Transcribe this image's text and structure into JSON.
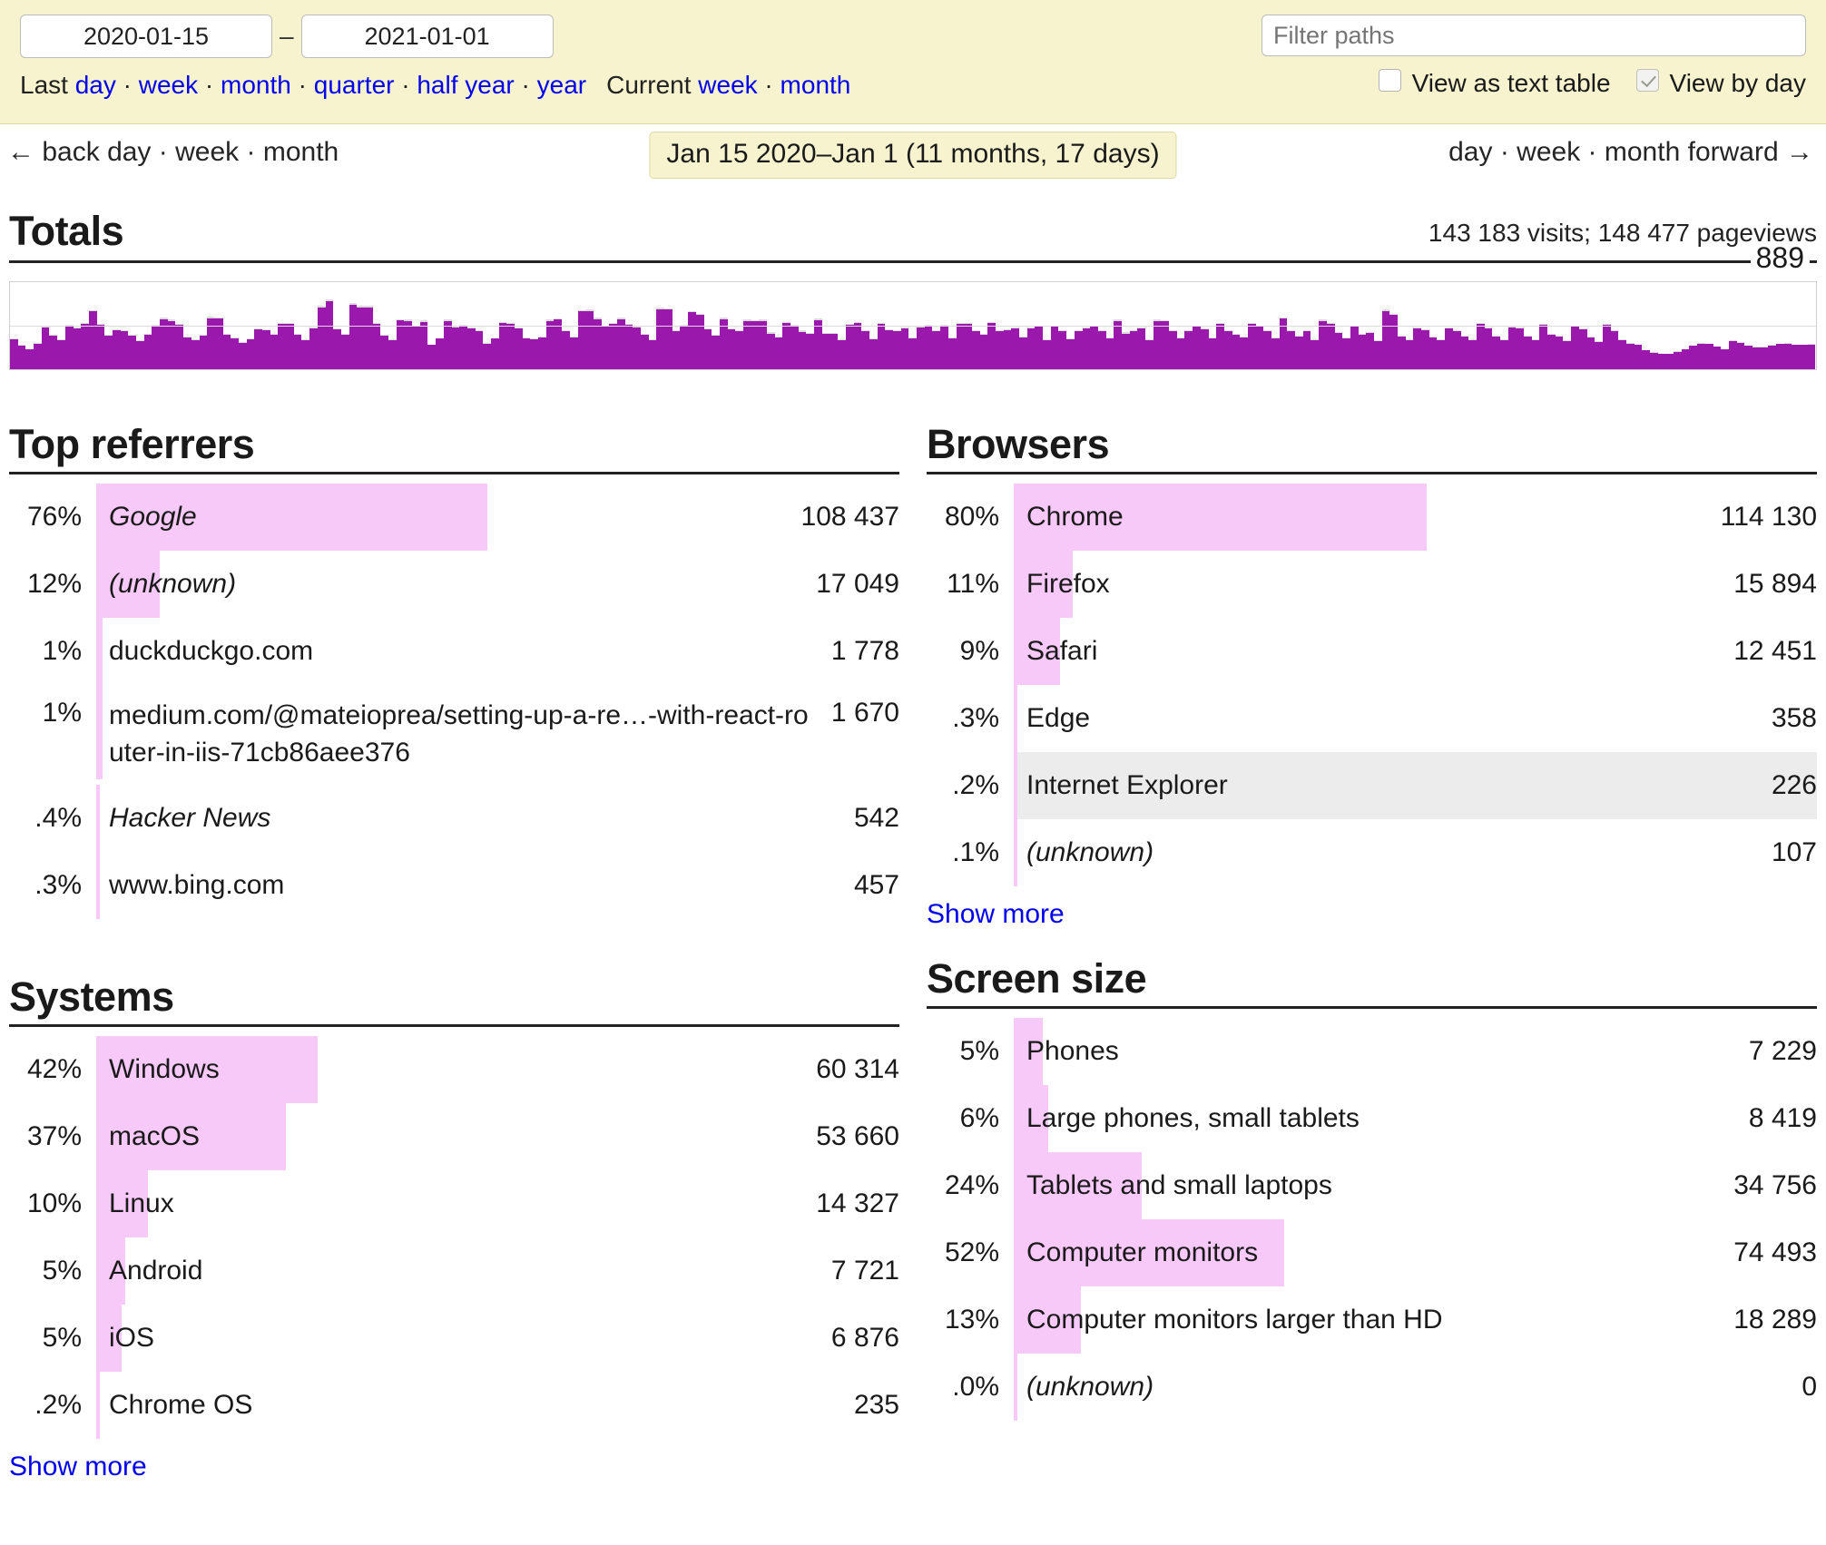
{
  "filter_bar": {
    "date_start": "2020-01-15",
    "date_end": "2021-01-01",
    "dash": "–",
    "last_label": "Last",
    "last_links": [
      "day",
      "week",
      "month",
      "quarter",
      "half year",
      "year"
    ],
    "current_label": "Current",
    "current_links": [
      "week",
      "month"
    ],
    "filter_placeholder": "Filter paths",
    "filter_value": "",
    "checkbox_text_table": "View as text table",
    "checkbox_text_table_checked": false,
    "checkbox_by_day": "View by day",
    "checkbox_by_day_checked": true
  },
  "nav": {
    "back_arrow": "←",
    "back_label": "back",
    "back_links": [
      "day",
      "week",
      "month"
    ],
    "range_badge": "Jan 15 2020–Jan 1 (11 months, 17 days)",
    "forward_links": [
      "day",
      "week",
      "month"
    ],
    "forward_label": "forward",
    "forward_arrow": "→"
  },
  "totals": {
    "title": "Totals",
    "summary": "143 183 visits; 148 477 pageviews",
    "chart_max_label": "889"
  },
  "colors": {
    "visits_bar": "#9a18ab",
    "pageviews_bar": "#dcdcdc",
    "stat_bar": "#f7c9f9",
    "hover_row": "#ececec",
    "link": "#0000ee",
    "header_bg": "#f7f3cf"
  },
  "chart_data": {
    "type": "bar",
    "title": "Totals",
    "xlabel": "",
    "ylabel": "visits",
    "ylim": [
      0,
      889
    ],
    "grid": true,
    "legend": [],
    "annotations": [
      "889"
    ],
    "series": [
      {
        "name": "pageviews",
        "values": [
          310,
          248,
          205,
          268,
          430,
          352,
          300,
          452,
          420,
          470,
          600,
          460,
          352,
          400,
          392,
          352,
          296,
          356,
          452,
          520,
          500,
          462,
          330,
          300,
          352,
          528,
          524,
          360,
          324,
          272,
          312,
          416,
          400,
          360,
          468,
          470,
          354,
          300,
          420,
          640,
          708,
          416,
          360,
          672,
          640,
          640,
          470,
          352,
          306,
          508,
          500,
          440,
          492,
          250,
          316,
          500,
          434,
          450,
          420,
          392,
          268,
          316,
          478,
          470,
          420,
          320,
          312,
          330,
          500,
          512,
          392,
          330,
          600,
          604,
          520,
          440,
          470,
          520,
          460,
          430,
          360,
          300,
          624,
          618,
          392,
          452,
          590,
          560,
          410,
          352,
          520,
          416,
          392,
          500,
          494,
          500,
          372,
          330,
          480,
          450,
          390,
          368,
          510,
          364,
          364,
          300,
          460,
          476,
          392,
          310,
          470,
          404,
          392,
          420,
          324,
          430,
          452,
          392,
          452,
          324,
          470,
          470,
          392,
          356,
          480,
          392,
          404,
          420,
          326,
          420,
          440,
          300,
          440,
          392,
          310,
          392,
          420,
          440,
          392,
          324,
          500,
          372,
          392,
          420,
          300,
          500,
          494,
          392,
          324,
          392,
          440,
          410,
          324,
          470,
          392,
          356,
          330,
          470,
          440,
          392,
          324,
          524,
          392,
          340,
          392,
          300,
          500,
          470,
          378,
          324,
          440,
          356,
          378,
          290,
          604,
          560,
          340,
          304,
          420,
          400,
          330,
          300,
          420,
          392,
          340,
          300,
          470,
          420,
          340,
          300,
          436,
          420,
          340,
          300,
          458,
          360,
          338,
          290,
          440,
          410,
          330,
          280,
          460,
          392,
          300,
          266,
          252,
          196,
          170,
          158,
          160,
          180,
          206,
          240,
          262,
          260,
          232,
          206,
          290,
          276,
          240,
          228,
          226,
          246,
          260,
          262,
          252,
          250,
          256
        ]
      },
      {
        "name": "visits",
        "values": [
          300,
          240,
          198,
          260,
          418,
          340,
          292,
          440,
          410,
          458,
          584,
          448,
          342,
          390,
          382,
          342,
          288,
          346,
          440,
          506,
          488,
          450,
          322,
          292,
          342,
          514,
          510,
          350,
          316,
          264,
          304,
          404,
          390,
          350,
          456,
          458,
          344,
          292,
          410,
          624,
          690,
          404,
          350,
          654,
          624,
          624,
          458,
          342,
          298,
          494,
          488,
          428,
          480,
          244,
          308,
          488,
          422,
          438,
          410,
          382,
          260,
          308,
          466,
          458,
          410,
          312,
          304,
          322,
          488,
          500,
          382,
          322,
          584,
          588,
          506,
          428,
          458,
          506,
          448,
          418,
          350,
          292,
          608,
          602,
          382,
          440,
          574,
          546,
          400,
          342,
          506,
          404,
          382,
          488,
          482,
          488,
          362,
          322,
          468,
          438,
          380,
          358,
          496,
          354,
          354,
          292,
          448,
          464,
          382,
          302,
          458,
          394,
          382,
          410,
          316,
          418,
          440,
          382,
          440,
          316,
          458,
          458,
          382,
          346,
          468,
          382,
          394,
          410,
          318,
          410,
          428,
          292,
          428,
          382,
          302,
          382,
          410,
          428,
          382,
          316,
          488,
          362,
          382,
          410,
          292,
          488,
          482,
          382,
          316,
          382,
          428,
          400,
          316,
          458,
          382,
          346,
          322,
          458,
          428,
          382,
          316,
          510,
          382,
          332,
          382,
          292,
          488,
          458,
          368,
          316,
          428,
          346,
          368,
          282,
          588,
          546,
          332,
          296,
          410,
          390,
          322,
          292,
          410,
          382,
          332,
          292,
          458,
          410,
          332,
          292,
          424,
          410,
          332,
          292,
          446,
          350,
          330,
          282,
          428,
          400,
          322,
          272,
          448,
          382,
          292,
          258,
          244,
          190,
          164,
          152,
          154,
          174,
          200,
          234,
          256,
          254,
          226,
          200,
          282,
          268,
          234,
          222,
          220,
          240,
          254,
          256,
          246,
          244,
          250
        ]
      }
    ]
  },
  "panels": {
    "top_referrers": {
      "title": "Top referrers",
      "rows": [
        {
          "pct": "76%",
          "name": "Google",
          "count": "108 437",
          "bar": 57.0,
          "italic": true,
          "hovered": false,
          "wrap": false
        },
        {
          "pct": "12%",
          "name": "(unknown)",
          "count": "17 049",
          "bar": 9.0,
          "italic": true,
          "hovered": false,
          "wrap": false
        },
        {
          "pct": "1%",
          "name": "duckduckgo.com",
          "count": "1 778",
          "bar": 0.9,
          "italic": false,
          "hovered": false,
          "wrap": false
        },
        {
          "pct": "1%",
          "name": "medium.com/@mateioprea/setting-up-a-re…-with-react-router-in-iis-71cb86aee376",
          "count": "1 670",
          "bar": 0.9,
          "italic": false,
          "hovered": false,
          "wrap": true
        },
        {
          "pct": ".4%",
          "name": "Hacker News",
          "count": "542",
          "bar": 0.5,
          "italic": true,
          "hovered": false,
          "wrap": false
        },
        {
          "pct": ".3%",
          "name": "www.bing.com",
          "count": "457",
          "bar": 0.4,
          "italic": false,
          "hovered": false,
          "wrap": false
        }
      ],
      "show_more": null
    },
    "browsers": {
      "title": "Browsers",
      "rows": [
        {
          "pct": "80%",
          "name": "Chrome",
          "count": "114 130",
          "bar": 60.0,
          "italic": false,
          "hovered": false,
          "wrap": false
        },
        {
          "pct": "11%",
          "name": "Firefox",
          "count": "15 894",
          "bar": 8.4,
          "italic": false,
          "hovered": false,
          "wrap": false
        },
        {
          "pct": "9%",
          "name": "Safari",
          "count": "12 451",
          "bar": 6.6,
          "italic": false,
          "hovered": false,
          "wrap": false
        },
        {
          "pct": ".3%",
          "name": "Edge",
          "count": "358",
          "bar": 0.35,
          "italic": false,
          "hovered": false,
          "wrap": false
        },
        {
          "pct": ".2%",
          "name": "Internet Explorer",
          "count": "226",
          "bar": 0.3,
          "italic": false,
          "hovered": true,
          "wrap": false
        },
        {
          "pct": ".1%",
          "name": "(unknown)",
          "count": "107",
          "bar": 0.25,
          "italic": true,
          "hovered": false,
          "wrap": false
        }
      ],
      "show_more": "Show more"
    },
    "systems": {
      "title": "Systems",
      "rows": [
        {
          "pct": "42%",
          "name": "Windows",
          "count": "60 314",
          "bar": 31.5,
          "italic": false,
          "hovered": false,
          "wrap": false
        },
        {
          "pct": "37%",
          "name": "macOS",
          "count": "53 660",
          "bar": 27.0,
          "italic": false,
          "hovered": false,
          "wrap": false
        },
        {
          "pct": "10%",
          "name": "Linux",
          "count": "14 327",
          "bar": 7.4,
          "italic": false,
          "hovered": false,
          "wrap": false
        },
        {
          "pct": "5%",
          "name": "Android",
          "count": "7 721",
          "bar": 4.0,
          "italic": false,
          "hovered": false,
          "wrap": false
        },
        {
          "pct": "5%",
          "name": "iOS",
          "count": "6 876",
          "bar": 3.6,
          "italic": false,
          "hovered": false,
          "wrap": false
        },
        {
          "pct": ".2%",
          "name": "Chrome OS",
          "count": "235",
          "bar": 0.3,
          "italic": false,
          "hovered": false,
          "wrap": false
        }
      ],
      "show_more": "Show more"
    },
    "screen_size": {
      "title": "Screen size",
      "rows": [
        {
          "pct": "5%",
          "name": "Phones",
          "count": "7 229",
          "bar": 4.0,
          "italic": false,
          "hovered": false,
          "wrap": false
        },
        {
          "pct": "6%",
          "name": "Large phones, small tablets",
          "count": "8 419",
          "bar": 4.8,
          "italic": false,
          "hovered": false,
          "wrap": false
        },
        {
          "pct": "24%",
          "name": "Tablets and small laptops",
          "count": "34 756",
          "bar": 18.2,
          "italic": false,
          "hovered": false,
          "wrap": false
        },
        {
          "pct": "52%",
          "name": "Computer monitors",
          "count": "74 493",
          "bar": 38.5,
          "italic": false,
          "hovered": false,
          "wrap": false
        },
        {
          "pct": "13%",
          "name": "Computer monitors larger than HD",
          "count": "18 289",
          "bar": 9.6,
          "italic": false,
          "hovered": false,
          "wrap": false
        },
        {
          "pct": ".0%",
          "name": "(unknown)",
          "count": "0",
          "bar": 0,
          "italic": true,
          "hovered": false,
          "wrap": false
        }
      ],
      "show_more": null
    }
  }
}
